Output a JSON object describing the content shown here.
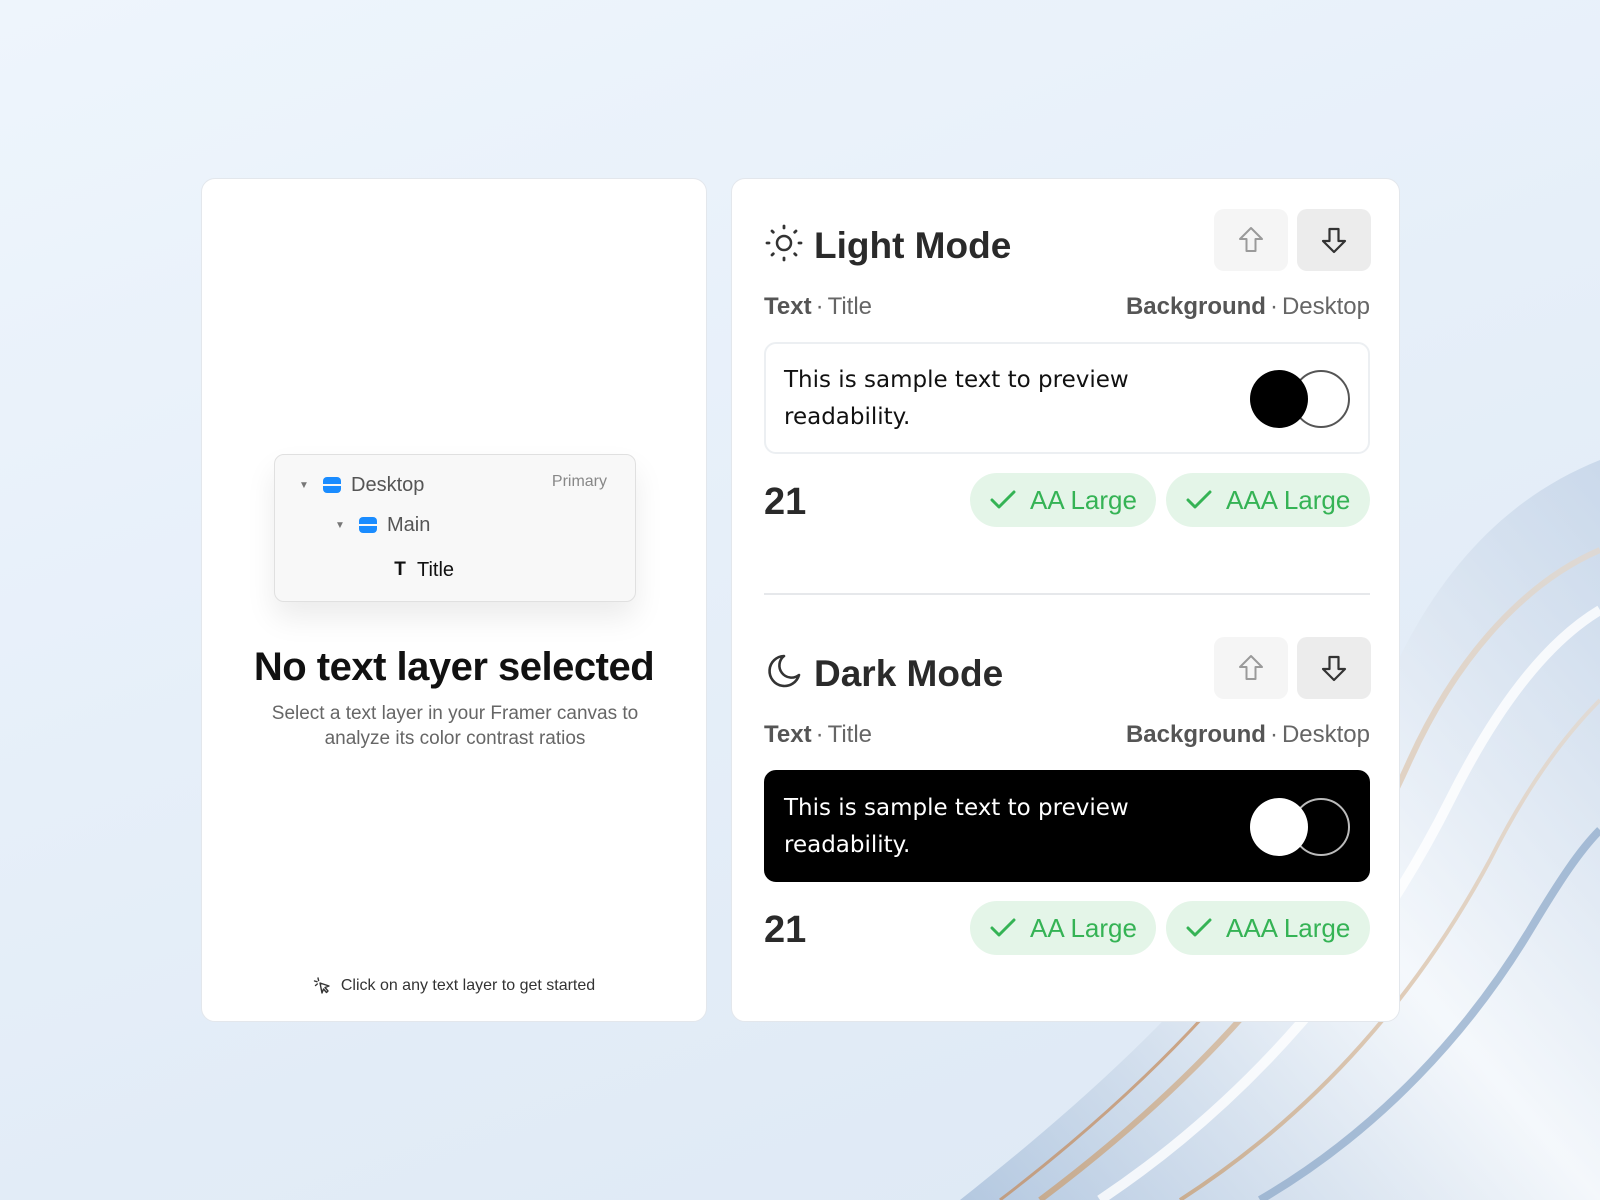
{
  "layers_panel": {
    "tree": {
      "root": {
        "label": "Desktop",
        "tag": "Primary"
      },
      "child": {
        "label": "Main"
      },
      "leaf": {
        "label": "Title"
      }
    },
    "empty_title": "No text layer selected",
    "empty_description": "Select a text layer in your Framer canvas to analyze its color contrast ratios",
    "hint": "Click on any text layer to get started"
  },
  "contrast_panel": {
    "light": {
      "title": "Light Mode",
      "text_label": "Text",
      "text_value": "Title",
      "bg_label": "Background",
      "bg_value": "Desktop",
      "preview_text": "This is sample text to preview readability.",
      "score": "21",
      "badges": [
        "AA Large",
        "AAA Large"
      ]
    },
    "dark": {
      "title": "Dark Mode",
      "text_label": "Text",
      "text_value": "Title",
      "bg_label": "Background",
      "bg_value": "Desktop",
      "preview_text": "This is sample text to preview readability.",
      "score": "21",
      "badges": [
        "AA Large",
        "AAA Large"
      ]
    },
    "separator": "·"
  },
  "colors": {
    "accent_blue": "#1a8cff",
    "pass_green": "#35b355",
    "pass_green_bg": "#e4f5e8"
  }
}
